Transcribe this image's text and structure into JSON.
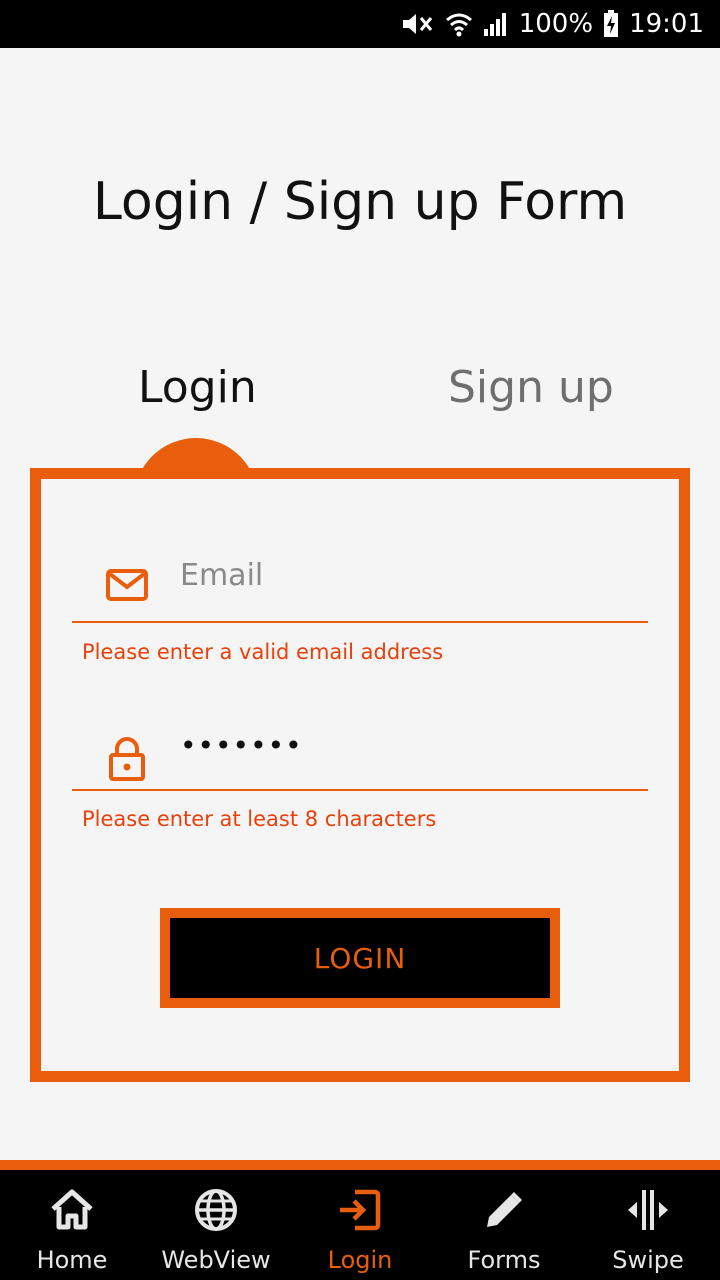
{
  "status_bar": {
    "battery": "100%",
    "time": "19:01"
  },
  "page": {
    "title": "Login / Sign up Form"
  },
  "tabs": [
    {
      "label": "Login",
      "active": true
    },
    {
      "label": "Sign up",
      "active": false
    }
  ],
  "form": {
    "email": {
      "placeholder": "Email",
      "value": "",
      "error": "Please enter a valid email address",
      "icon": "mail-icon"
    },
    "password": {
      "value": "•••••••",
      "error": "Please enter at least 8 characters",
      "icon": "lock-icon"
    },
    "submit_label": "LOGIN"
  },
  "bottom_nav": [
    {
      "label": "Home",
      "icon": "home-icon",
      "active": false
    },
    {
      "label": "WebView",
      "icon": "globe-icon",
      "active": false
    },
    {
      "label": "Login",
      "icon": "login-icon",
      "active": true
    },
    {
      "label": "Forms",
      "icon": "pencil-icon",
      "active": false
    },
    {
      "label": "Swipe",
      "icon": "swipe-icon",
      "active": false
    }
  ],
  "colors": {
    "accent": "#e95e0c",
    "error": "#e9400c",
    "background": "#f5f5f5",
    "nav_background": "#000000"
  }
}
